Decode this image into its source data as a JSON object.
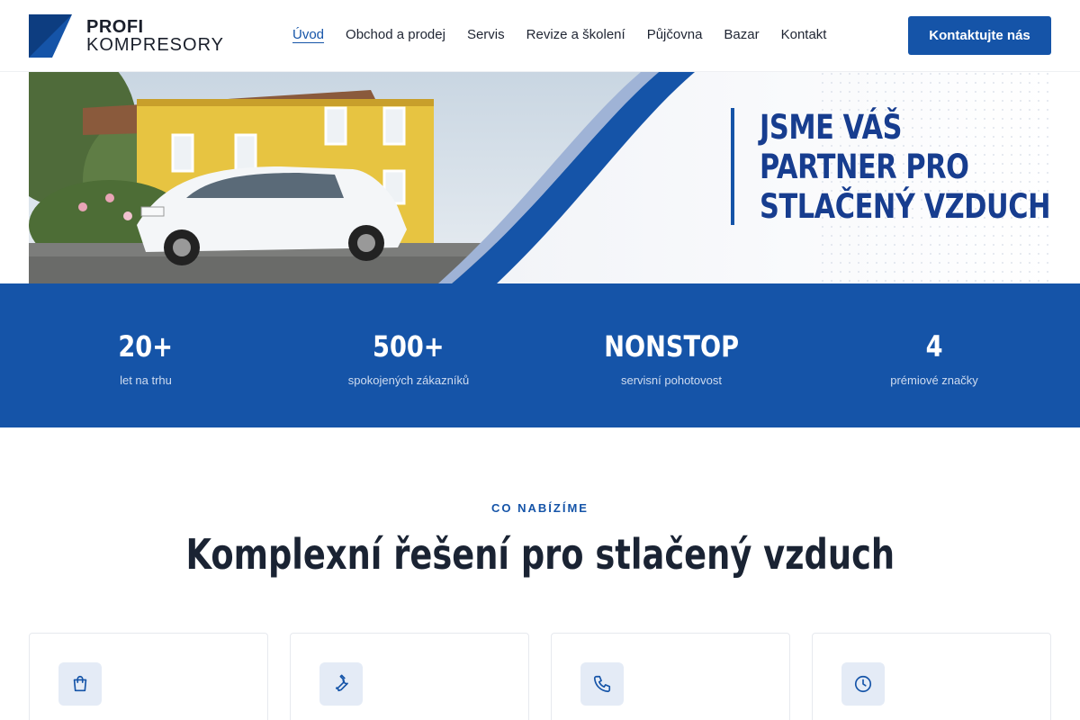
{
  "brand": {
    "line1": "PROFI",
    "line2": "KOMPRESORY"
  },
  "nav": {
    "items": [
      {
        "label": "Úvod",
        "active": true
      },
      {
        "label": "Obchod a prodej"
      },
      {
        "label": "Servis"
      },
      {
        "label": "Revize a školení"
      },
      {
        "label": "Půjčovna"
      },
      {
        "label": "Bazar"
      },
      {
        "label": "Kontakt"
      }
    ],
    "cta_label": "Kontaktujte nás"
  },
  "hero": {
    "slogan": [
      "JSME VÁŠ",
      "PARTNER PRO",
      "STLAČENÝ VZDUCH"
    ]
  },
  "stats": [
    {
      "value": "20+",
      "label": "let na trhu"
    },
    {
      "value": "500+",
      "label": "spokojených zákazníků"
    },
    {
      "value": "NONSTOP",
      "label": "servisní pohotovost"
    },
    {
      "value": "4",
      "label": "prémiové značky"
    }
  ],
  "section": {
    "eyebrow": "CO NABÍZÍME",
    "title": "Komplexní řešení pro stlačený vzduch"
  },
  "cards": [
    {
      "icon": "shopping-bag-icon"
    },
    {
      "icon": "wrench-icon"
    },
    {
      "icon": "phone-icon"
    },
    {
      "icon": "clock-icon"
    }
  ],
  "colors": {
    "primary": "#1554a8",
    "slogan": "#173d8f",
    "icon_bg": "#e4ebf6"
  }
}
